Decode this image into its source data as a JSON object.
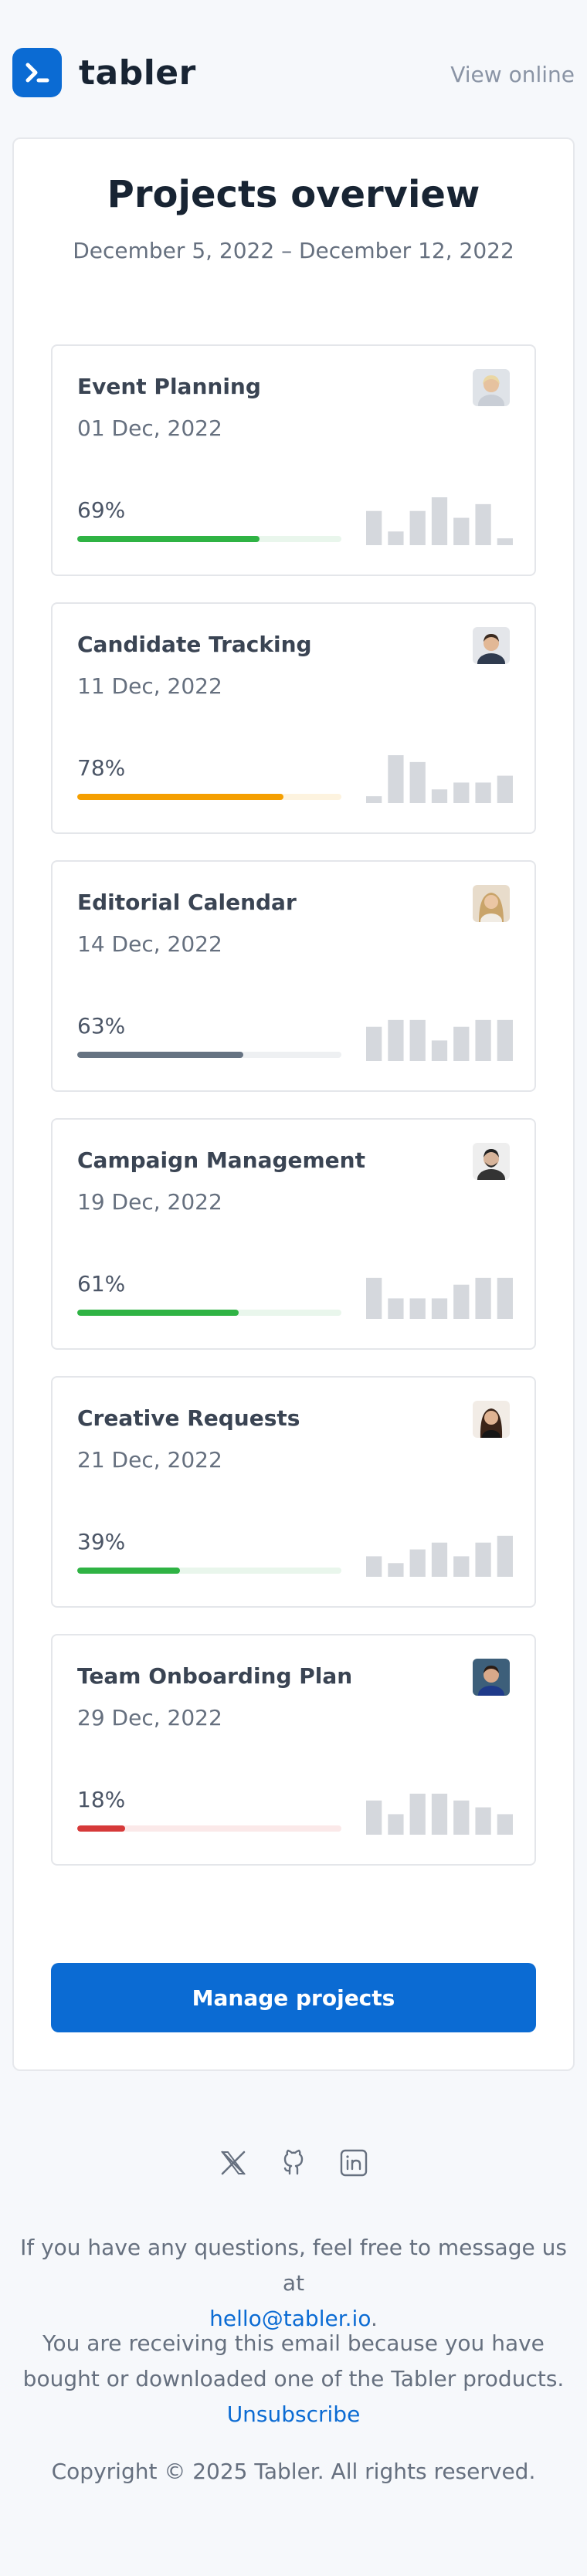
{
  "header": {
    "brand": "tabler",
    "view_online": "View online"
  },
  "overview": {
    "title": "Projects overview",
    "date_range": "December 5, 2022 – December 12, 2022"
  },
  "projects": [
    {
      "name": "Event Planning",
      "date": "01 Dec, 2022",
      "percent": "69%",
      "progress": 0.69,
      "color": "#2fb344",
      "track": "#e9f6ec",
      "spark": [
        5,
        2,
        5,
        7,
        4,
        6,
        1
      ]
    },
    {
      "name": "Candidate Tracking",
      "date": "11 Dec, 2022",
      "percent": "78%",
      "progress": 0.78,
      "color": "#f59f00",
      "track": "#fdf3df",
      "spark": [
        1,
        7,
        6,
        2,
        3,
        3,
        4
      ]
    },
    {
      "name": "Editorial Calendar",
      "date": "14 Dec, 2022",
      "percent": "63%",
      "progress": 0.63,
      "color": "#667382",
      "track": "#eef0f2",
      "spark": [
        5,
        6,
        6,
        3,
        5,
        6,
        6
      ]
    },
    {
      "name": "Campaign Management",
      "date": "19 Dec, 2022",
      "percent": "61%",
      "progress": 0.61,
      "color": "#2fb344",
      "track": "#e9f6ec",
      "spark": [
        6,
        3,
        3,
        3,
        5,
        6,
        6
      ]
    },
    {
      "name": "Creative Requests",
      "date": "21 Dec, 2022",
      "percent": "39%",
      "progress": 0.39,
      "color": "#2fb344",
      "track": "#e9f6ec",
      "spark": [
        3,
        2,
        4,
        5,
        3,
        5,
        6
      ]
    },
    {
      "name": "Team Onboarding Plan",
      "date": "29 Dec, 2022",
      "percent": "18%",
      "progress": 0.18,
      "color": "#d63939",
      "track": "#fbe9e9",
      "spark": [
        5,
        3,
        6,
        6,
        5,
        4,
        3
      ]
    }
  ],
  "actions": {
    "manage": "Manage projects"
  },
  "footer": {
    "social_icons": [
      "x-icon",
      "github-icon",
      "linkedin-icon"
    ],
    "questions": "If you have any questions, feel free to message us at",
    "email": "hello@tabler.io",
    "receiving": "You are receiving this email because you have bought or downloaded one of the Tabler products.",
    "unsubscribe": "Unsubscribe",
    "copyright": "Copyright © 2025 Tabler. All rights reserved."
  }
}
